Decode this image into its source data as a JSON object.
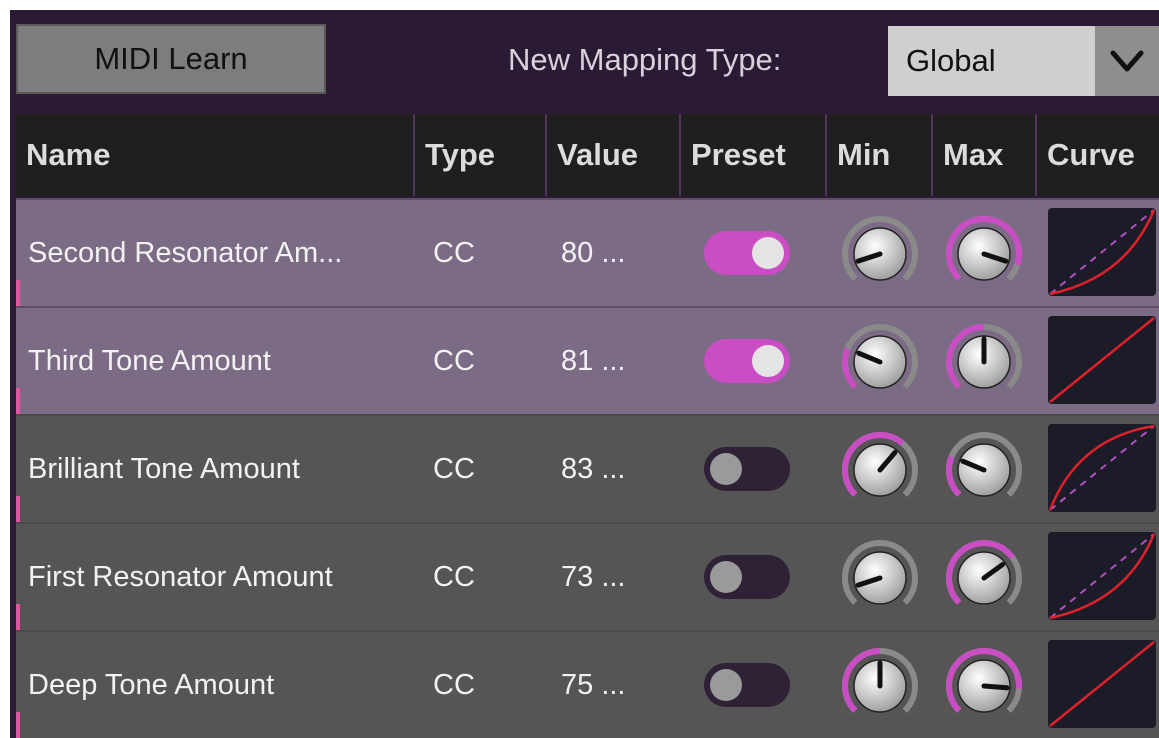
{
  "toolbar": {
    "midi_learn_label": "MIDI Learn",
    "mapping_type_label": "New Mapping Type:",
    "mapping_type_value": "Global",
    "chevron_icon": "chevron-down-icon"
  },
  "colors": {
    "accent": "#c94ec4",
    "panel_bg": "#2b1a33",
    "row_selected": "#7c6b85",
    "row_normal": "#555555",
    "curve_line": "#e0202a",
    "knob_track_gray": "#8a8a8a"
  },
  "table": {
    "columns": [
      "Name",
      "Type",
      "Value",
      "Preset",
      "Min",
      "Max",
      "Curve"
    ],
    "rows": [
      {
        "name": "Second Resonator Am...",
        "type": "CC",
        "value": "80 ...",
        "preset_on": true,
        "min": 0.1,
        "max": 0.9,
        "min_active": false,
        "max_active": true,
        "curve": "exp",
        "selected": true
      },
      {
        "name": "Third Tone Amount",
        "type": "CC",
        "value": "81 ...",
        "preset_on": true,
        "min": 0.25,
        "max": 0.5,
        "min_active": true,
        "max_active": true,
        "curve": "linear",
        "selected": true
      },
      {
        "name": "Brilliant Tone Amount",
        "type": "CC",
        "value": "83 ...",
        "preset_on": false,
        "min": 0.65,
        "max": 0.25,
        "min_active": true,
        "max_active": true,
        "curve": "log",
        "selected": false
      },
      {
        "name": "First Resonator Amount",
        "type": "CC",
        "value": "73 ...",
        "preset_on": false,
        "min": 0.1,
        "max": 0.7,
        "min_active": false,
        "max_active": true,
        "curve": "exp",
        "selected": false
      },
      {
        "name": "Deep Tone Amount",
        "type": "CC",
        "value": "75 ...",
        "preset_on": false,
        "min": 0.5,
        "max": 0.85,
        "min_active": true,
        "max_active": true,
        "curve": "linear",
        "selected": false
      }
    ]
  }
}
